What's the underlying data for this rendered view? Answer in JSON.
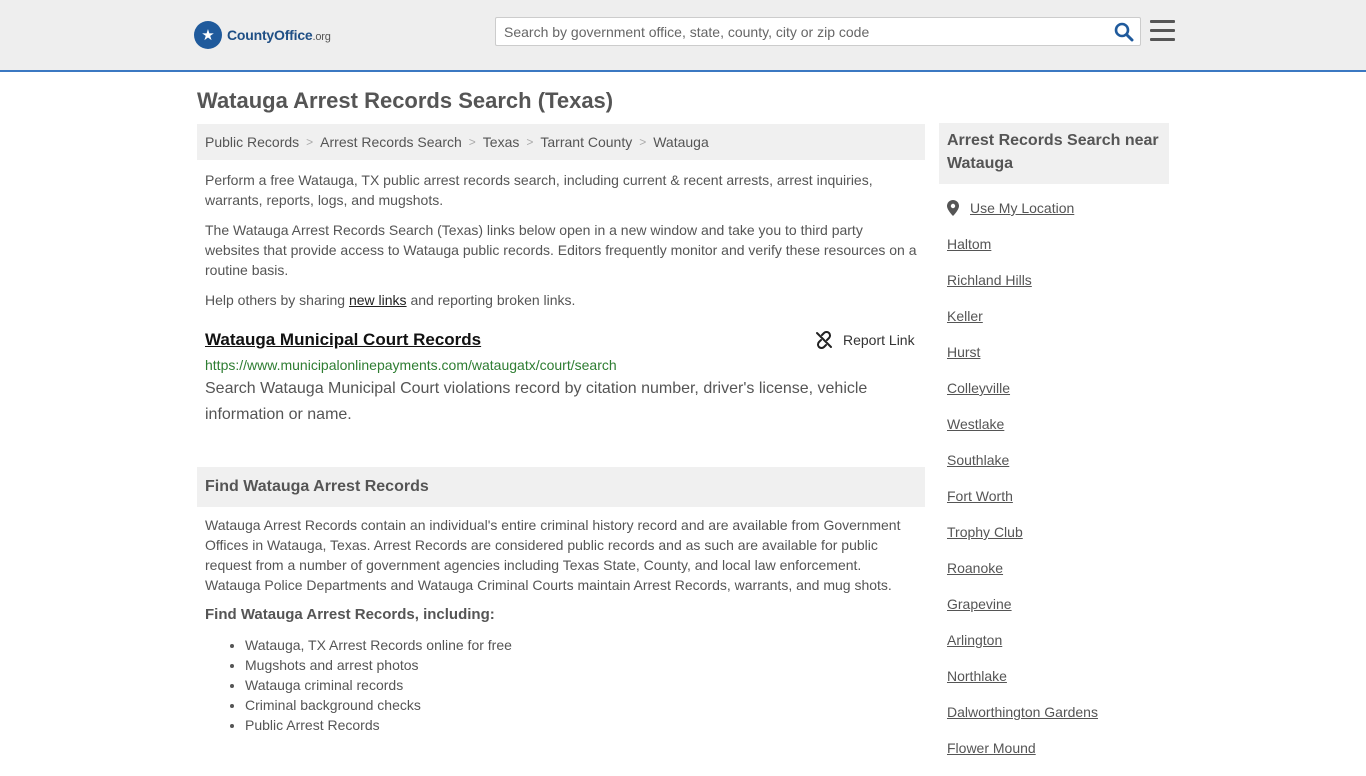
{
  "header": {
    "logo_brand": "CountyOffice",
    "logo_tld": ".org",
    "search_placeholder": "Search by government office, state, county, city or zip code"
  },
  "page_title": "Watauga Arrest Records Search (Texas)",
  "breadcrumb": [
    "Public Records",
    "Arrest Records Search",
    "Texas",
    "Tarrant County",
    "Watauga"
  ],
  "intro": {
    "p1": "Perform a free Watauga, TX public arrest records search, including current & recent arrests, arrest inquiries, warrants, reports, logs, and mugshots.",
    "p2": "The Watauga Arrest Records Search (Texas) links below open in a new window and take you to third party websites that provide access to Watauga public records. Editors frequently monitor and verify these resources on a routine basis.",
    "p3_before": "Help others by sharing ",
    "p3_link": "new links",
    "p3_after": " and reporting broken links."
  },
  "result": {
    "title": "Watauga Municipal Court Records",
    "report_label": "Report Link",
    "url": "https://www.municipalonlinepayments.com/wataugatx/court/search",
    "description": "Search Watauga Municipal Court violations record by citation number, driver's license, vehicle information or name."
  },
  "find_section": {
    "heading": "Find Watauga Arrest Records",
    "body": "Watauga Arrest Records contain an individual's entire criminal history record and are available from Government Offices in Watauga, Texas. Arrest Records are considered public records and as such are available for public request from a number of government agencies including Texas State, County, and local law enforcement. Watauga Police Departments and Watauga Criminal Courts maintain Arrest Records, warrants, and mug shots.",
    "subheading": "Find Watauga Arrest Records, including:",
    "bullets": [
      "Watauga, TX Arrest Records online for free",
      "Mugshots and arrest photos",
      "Watauga criminal records",
      "Criminal background checks",
      "Public Arrest Records"
    ]
  },
  "sidebar": {
    "heading": "Arrest Records Search near Watauga",
    "use_location": "Use My Location",
    "nearby": [
      "Haltom",
      "Richland Hills",
      "Keller",
      "Hurst",
      "Colleyville",
      "Westlake",
      "Southlake",
      "Fort Worth",
      "Trophy Club",
      "Roanoke",
      "Grapevine",
      "Arlington",
      "Northlake",
      "Dalworthington Gardens",
      "Flower Mound"
    ]
  },
  "colors": {
    "header_bg": "#eeeeee",
    "header_border": "#3b78c2",
    "brand_blue": "#1f5a9c",
    "url_green": "#2e7d32",
    "panel_bg": "#f0f0f0"
  },
  "icons": {
    "logo": "eagle-seal-icon",
    "search": "search-icon",
    "menu": "hamburger-menu-icon",
    "report": "broken-link-icon",
    "location": "map-pin-icon"
  }
}
